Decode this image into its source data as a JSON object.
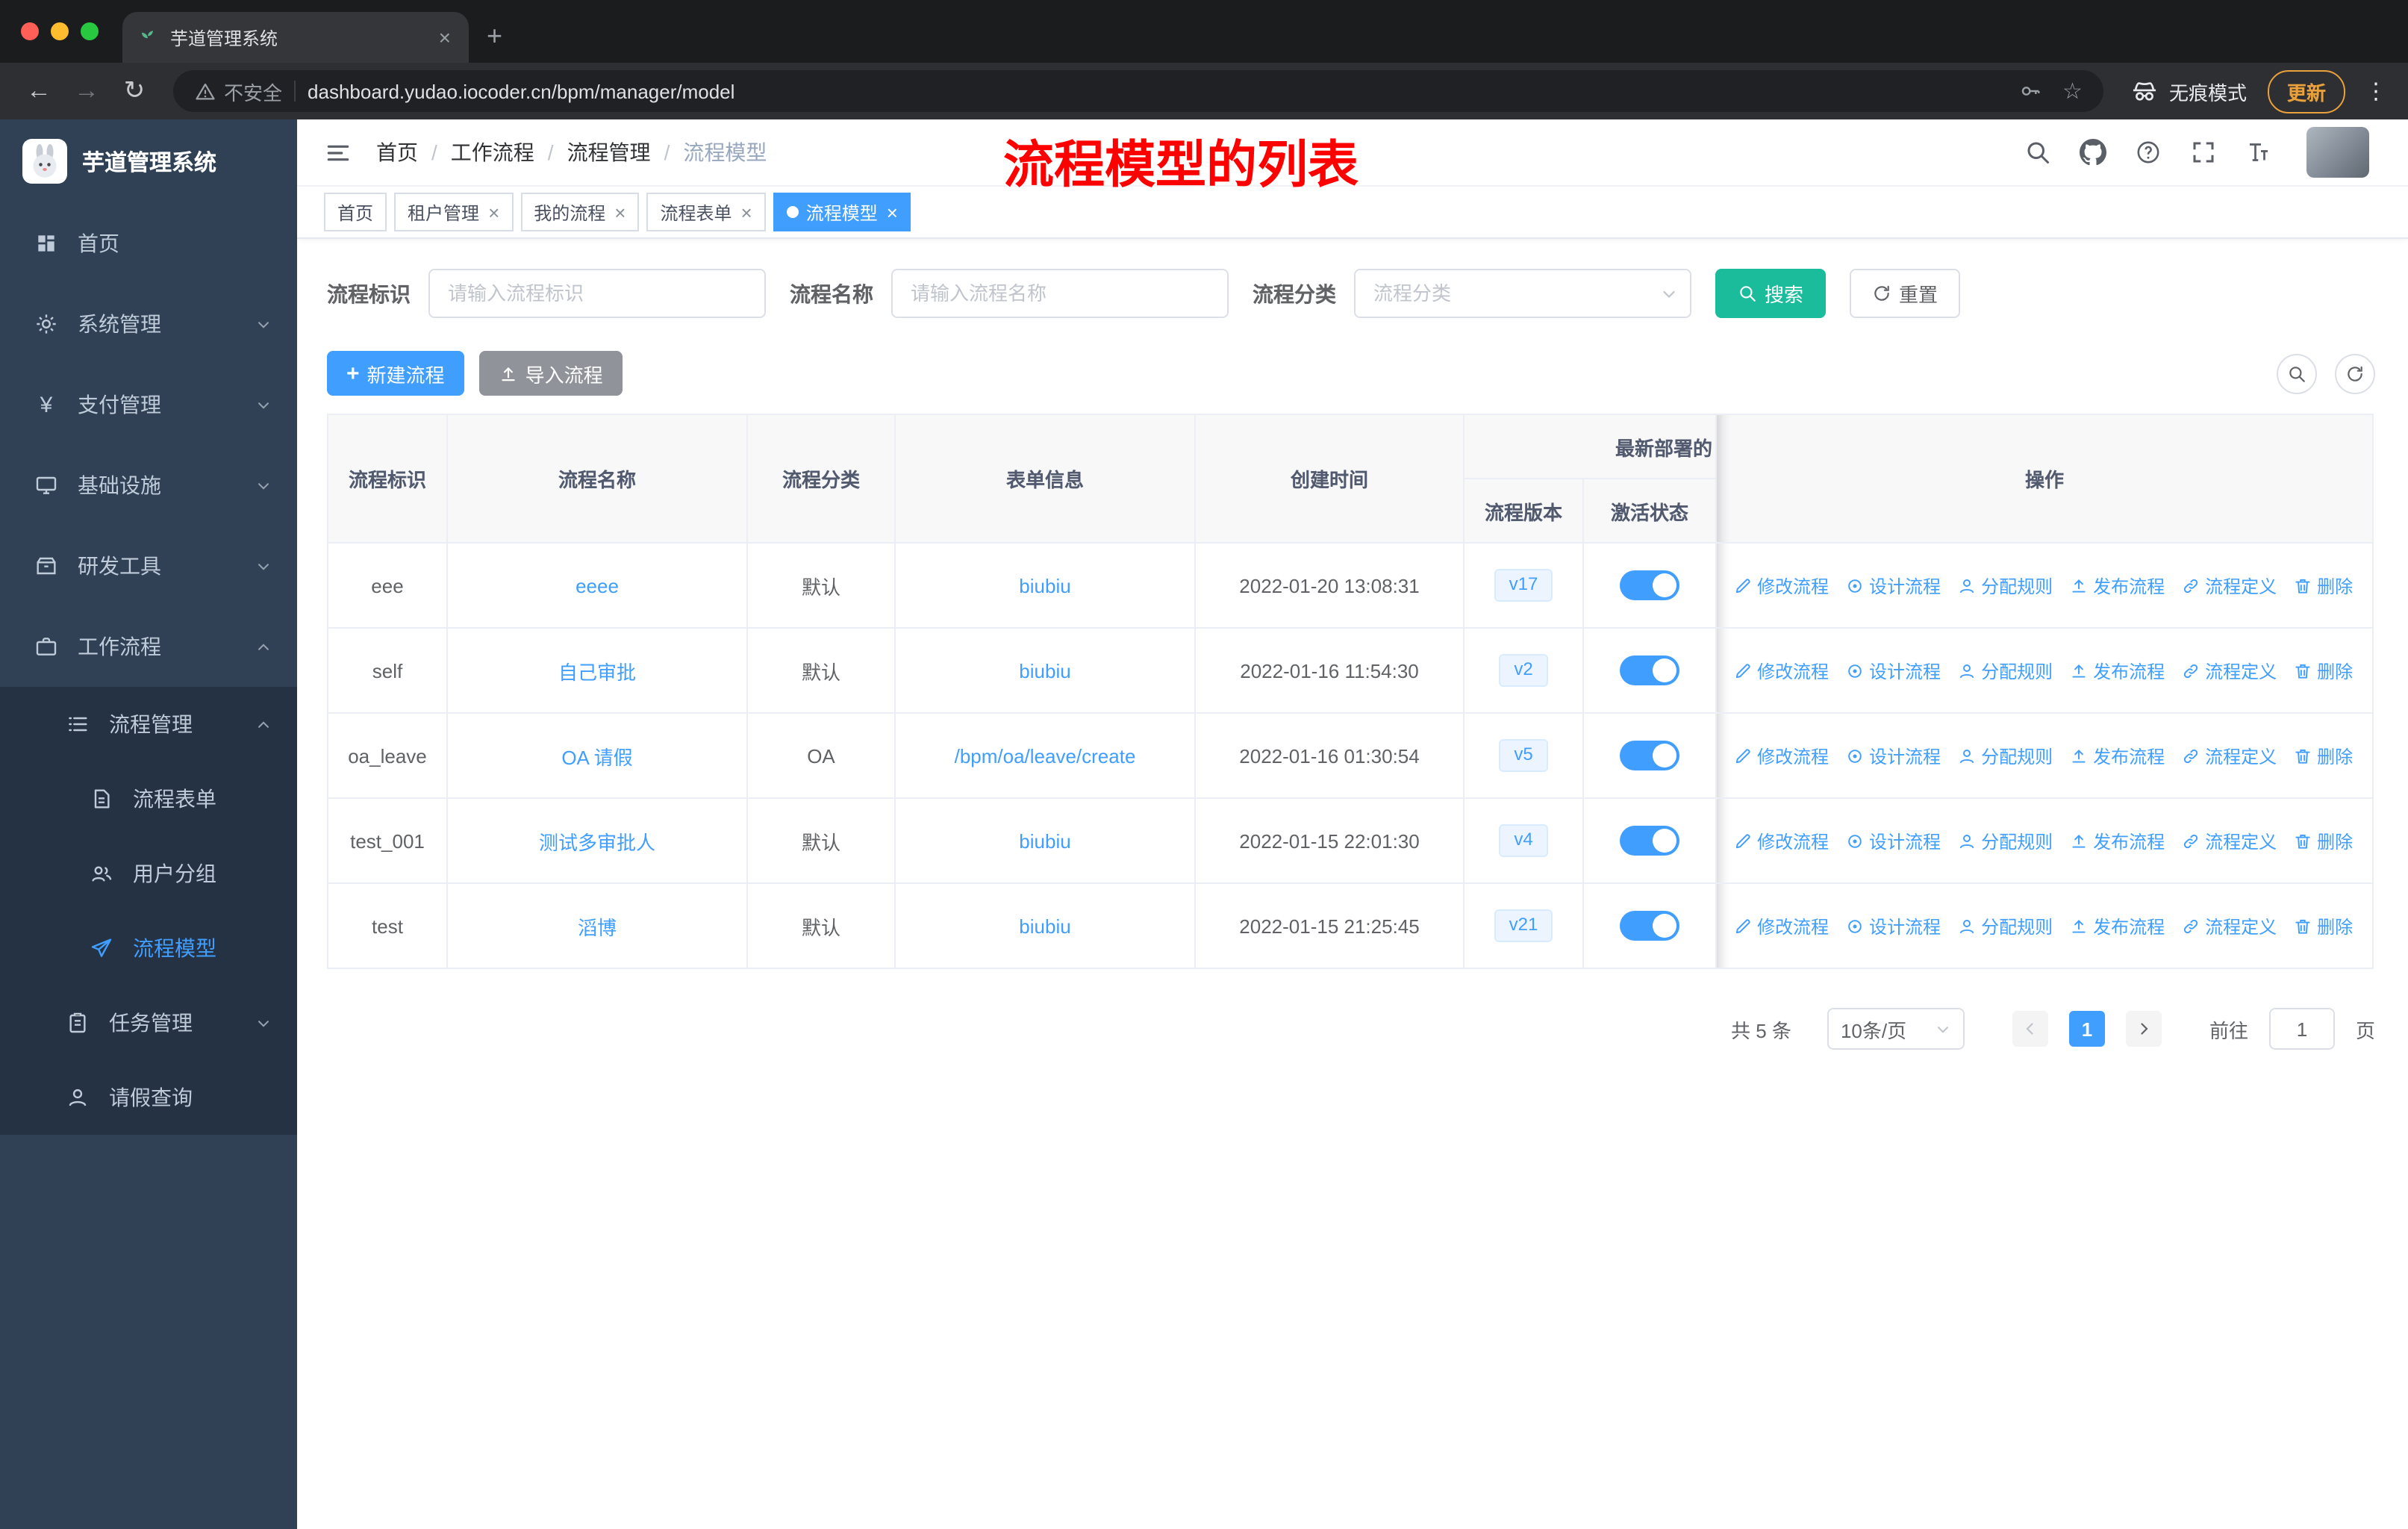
{
  "theme": {
    "primary": "#409eff",
    "teal": "#1abc9c",
    "sidebar-bg": "#304156",
    "submenu-bg": "#243244",
    "annotation-red": "#ff0000"
  },
  "browser": {
    "tab_title": "芋道管理系统",
    "security_label": "不安全",
    "url": "dashboard.yudao.iocoder.cn/bpm/manager/model",
    "incognito_label": "无痕模式",
    "update_label": "更新"
  },
  "glyphs": {
    "close": "×",
    "plus": "+",
    "back": "←",
    "forward": "→",
    "reload": "↻",
    "star": "☆",
    "more": "⋮",
    "yen": "¥"
  },
  "sidebar": {
    "logo_title": "芋道管理系统",
    "items": [
      {
        "label": "首页"
      },
      {
        "label": "系统管理"
      },
      {
        "label": "支付管理"
      },
      {
        "label": "基础设施"
      },
      {
        "label": "研发工具"
      },
      {
        "label": "工作流程"
      },
      {
        "label": "流程管理"
      },
      {
        "label": "流程表单"
      },
      {
        "label": "用户分组"
      },
      {
        "label": "流程模型"
      },
      {
        "label": "任务管理"
      },
      {
        "label": "请假查询"
      }
    ]
  },
  "header": {
    "breadcrumb": [
      "首页",
      "工作流程",
      "流程管理",
      "流程模型"
    ],
    "sep": "/",
    "annotation": "流程模型的列表"
  },
  "tags": [
    {
      "label": "首页"
    },
    {
      "label": "租户管理"
    },
    {
      "label": "我的流程"
    },
    {
      "label": "流程表单"
    },
    {
      "label": "流程模型"
    }
  ],
  "filters": {
    "id_label": "流程标识",
    "id_placeholder": "请输入流程标识",
    "name_label": "流程名称",
    "name_placeholder": "请输入流程名称",
    "category_label": "流程分类",
    "category_placeholder": "流程分类",
    "search_label": "搜索",
    "reset_label": "重置"
  },
  "toolbar": {
    "create_label": "新建流程",
    "import_label": "导入流程"
  },
  "table": {
    "headers": {
      "id": "流程标识",
      "name": "流程名称",
      "category": "流程分类",
      "form": "表单信息",
      "created": "创建时间",
      "deploy_group": "最新部署的",
      "version": "流程版本",
      "active": "激活状态",
      "ops": "操作"
    },
    "rows": [
      {
        "id": "eee",
        "name": "eeee",
        "category": "默认",
        "form": "biubiu",
        "created": "2022-01-20 13:08:31",
        "version": "v17",
        "active": true
      },
      {
        "id": "self",
        "name": "自己审批",
        "category": "默认",
        "form": "biubiu",
        "created": "2022-01-16 11:54:30",
        "version": "v2",
        "active": true
      },
      {
        "id": "oa_leave",
        "name": "OA 请假",
        "category": "OA",
        "form": "/bpm/oa/leave/create",
        "created": "2022-01-16 01:30:54",
        "version": "v5",
        "active": true
      },
      {
        "id": "test_001",
        "name": "测试多审批人",
        "category": "默认",
        "form": "biubiu",
        "created": "2022-01-15 22:01:30",
        "version": "v4",
        "active": true
      },
      {
        "id": "test",
        "name": "滔博",
        "category": "默认",
        "form": "biubiu",
        "created": "2022-01-15 21:25:45",
        "version": "v21",
        "active": true
      }
    ]
  },
  "ops": {
    "edit": "修改流程",
    "design": "设计流程",
    "assign": "分配规则",
    "publish": "发布流程",
    "definition": "流程定义",
    "remove": "删除"
  },
  "pagination": {
    "total": "共 5 条",
    "page_size": "10条/页",
    "page": "1",
    "goto_label": "前往",
    "unit_label": "页",
    "goto_value": "1"
  }
}
